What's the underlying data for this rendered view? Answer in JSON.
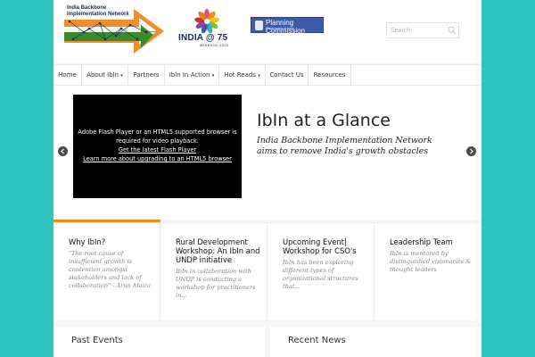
{
  "header": {
    "logo_ibin_line1": "India Backbone",
    "logo_ibin_line2": "Implementation Network",
    "logo_75_main": "INDIA @ 75",
    "logo_75_sub": "MISSION 2022",
    "logo_pc_title": "Planning Commission",
    "logo_pc_sub": "Government of India",
    "search_placeholder": "Search"
  },
  "nav": {
    "items": [
      {
        "label": "Home",
        "dropdown": false
      },
      {
        "label": "About Ibln",
        "dropdown": true
      },
      {
        "label": "Partners",
        "dropdown": false
      },
      {
        "label": "Ibln In Action",
        "dropdown": true
      },
      {
        "label": "Hot Reads",
        "dropdown": true
      },
      {
        "label": "Contact Us",
        "dropdown": false
      },
      {
        "label": "Resources",
        "dropdown": false
      }
    ],
    "dropdown_glyph": "▾"
  },
  "slider": {
    "video": {
      "line1": "Adobe Flash Player or an HTML5 supported browser is",
      "line2": "required for video playback.",
      "link1": "Get the latest Flash Player",
      "link2": "Learn more about upgrading to an HTML5 browser"
    },
    "title": "IbIn at a Glance",
    "subtitle": "India Backbone Implementation Network aims to remove India's growth obstacles"
  },
  "features": [
    {
      "title": "Why IbIn?",
      "body": "\"The root cause of insufficient growth is contention amongst stakeholders and lack of collaboration\" - Arun Maira"
    },
    {
      "title": "Rural Development Workshop: An IbIn and UNDP initiative",
      "body": "IbIn in collaboration with UNDP is conducting a workshop for practitioners in..."
    },
    {
      "title": "Upcoming Event| Workshop for CSO's",
      "body": "IbIn has been exploring different types of organizational structures that..."
    },
    {
      "title": "Leadership Team",
      "body": "IbIn is mentored by distinguished visionaries & thought leaders"
    }
  ],
  "sections": {
    "past_events": "Past Events",
    "recent_news": "Recent News"
  },
  "colors": {
    "background": "#2ec4c0",
    "accent": "#f08c1e",
    "planning_commission_blue": "#3d5aa8"
  }
}
